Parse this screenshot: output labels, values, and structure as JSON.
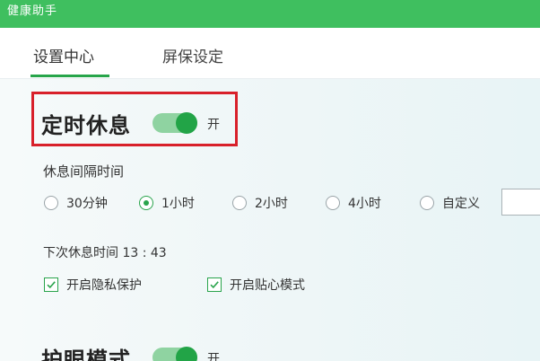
{
  "window": {
    "title": "健康助手"
  },
  "tabs": [
    {
      "label": "设置中心",
      "active": true
    },
    {
      "label": "屏保设定",
      "active": false
    }
  ],
  "rest": {
    "title": "定时休息",
    "toggle_on": true,
    "toggle_label": "开",
    "interval_label": "休息间隔时间",
    "options": [
      {
        "label": "30分钟",
        "checked": false
      },
      {
        "label": "1小时",
        "checked": true
      },
      {
        "label": "2小时",
        "checked": false
      },
      {
        "label": "4小时",
        "checked": false
      },
      {
        "label": "自定义",
        "checked": false
      }
    ],
    "custom_value": "",
    "next_rest": "下次休息时间 13 : 43",
    "checkboxes": [
      {
        "label": "开启隐私保护",
        "checked": true
      },
      {
        "label": "开启贴心模式",
        "checked": true
      }
    ]
  },
  "eye": {
    "title": "护眼模式",
    "toggle_on": true,
    "toggle_label": "开"
  },
  "colors": {
    "title_bar": "#3fbf5f",
    "accent": "#27a54a",
    "highlight_border": "#d8202a"
  }
}
